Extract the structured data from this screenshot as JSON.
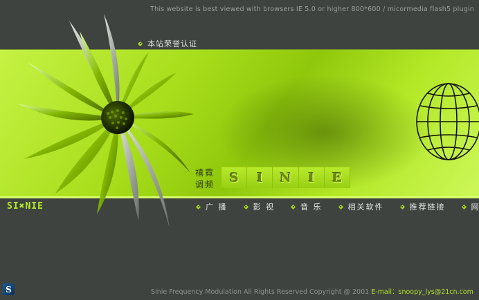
{
  "header": {
    "browser_note": "This website is best viewed with browsers IE 5.0 or higher 800*600 / micormedia flash5 plugin",
    "honor_link": "本站荣誉认证"
  },
  "hero": {
    "vibe_line1": "禧霓",
    "vibe_line2": "调频",
    "sinie_letters": [
      "S",
      "I",
      "N",
      "I",
      "E"
    ]
  },
  "brand": {
    "logo_text": "SI✖NIE"
  },
  "nav": {
    "items": [
      {
        "label": "广 播"
      },
      {
        "label": "影 视"
      },
      {
        "label": "音 乐"
      },
      {
        "label": "相关软件"
      },
      {
        "label": "推荐链接"
      },
      {
        "label": "网站声明"
      }
    ]
  },
  "footer": {
    "copyright": "Sinie Frequency Modulation All Rights Reserved Copyright @ 2001 ",
    "email": "E-mail：snoopy_lys@21cn.com",
    "badge": "S"
  },
  "colors": {
    "accent": "#a7d918",
    "background": "#3e4340",
    "band": "#a7dd1a"
  },
  "icons": [
    "diamond-bullet-icon",
    "flower-image",
    "globe-icon"
  ]
}
